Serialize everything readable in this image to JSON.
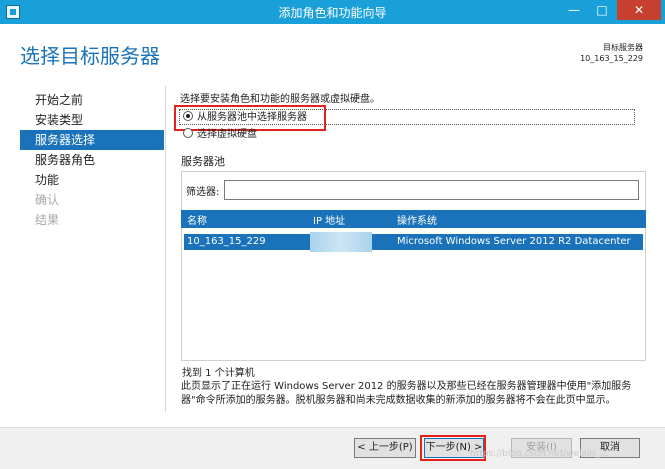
{
  "window": {
    "title": "添加角色和功能向导",
    "minimize_glyph": "—",
    "maximize_glyph": "□",
    "close_glyph": "✕"
  },
  "header": {
    "title": "选择目标服务器",
    "target_label": "目标服务器",
    "target_name": "10_163_15_229"
  },
  "nav": {
    "items": [
      {
        "label": "开始之前",
        "state": "normal"
      },
      {
        "label": "安装类型",
        "state": "normal"
      },
      {
        "label": "服务器选择",
        "state": "active"
      },
      {
        "label": "服务器角色",
        "state": "normal"
      },
      {
        "label": "功能",
        "state": "normal"
      },
      {
        "label": "确认",
        "state": "disabled"
      },
      {
        "label": "结果",
        "state": "disabled"
      }
    ]
  },
  "main": {
    "description": "选择要安装角色和功能的服务器或虚拟硬盘。",
    "options": [
      {
        "label": "从服务器池中选择服务器",
        "selected": true
      },
      {
        "label": "选择虚拟硬盘",
        "selected": false
      }
    ],
    "pool_label": "服务器池",
    "filter_label": "筛选器:",
    "filter_value": "",
    "table": {
      "columns": [
        "名称",
        "IP 地址",
        "操作系统"
      ],
      "rows": [
        {
          "name": "10_163_15_229",
          "ip": "",
          "os": "Microsoft Windows Server 2012 R2 Datacenter"
        }
      ]
    },
    "found_text": "找到 1 个计算机",
    "info_text": "此页显示了正在运行 Windows Server 2012 的服务器以及那些已经在服务器管理器中使用\"添加服务器\"命令所添加的服务器。脱机服务器和尚未完成数据收集的新添加的服务器将不会在此页中显示。"
  },
  "footer": {
    "prev_label": "< 上一步(P)",
    "next_label": "下一步(N) >",
    "install_label": "安装(I)",
    "cancel_label": "取消"
  },
  "watermark": "https://blog.csdn.net/weixin_...",
  "colors": {
    "titlebar": "#1aa0d8",
    "accent": "#1a73ba",
    "close": "#c7402f",
    "highlight_box": "#e5211b"
  }
}
